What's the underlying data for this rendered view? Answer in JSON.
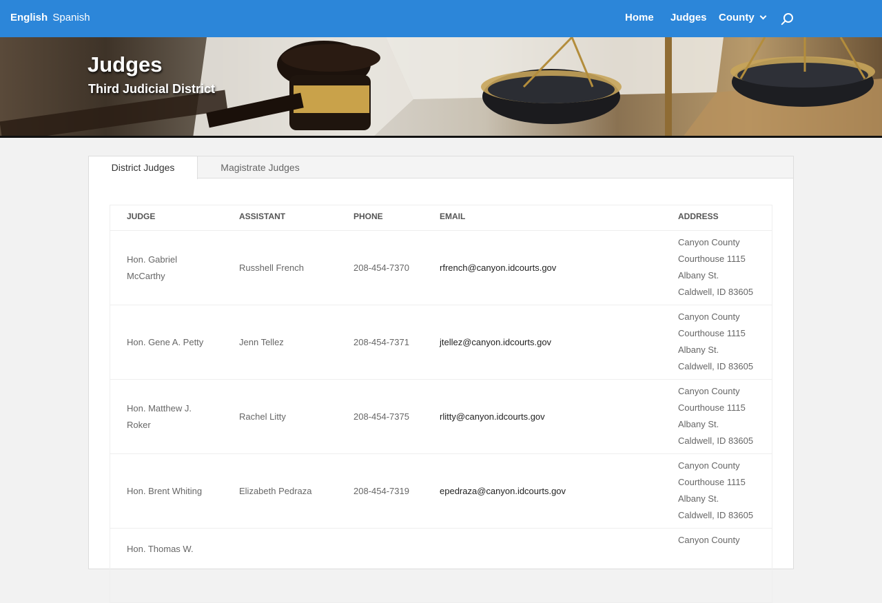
{
  "topbar": {
    "lang_english": "English",
    "lang_spanish": "Spanish",
    "nav": {
      "home": "Home",
      "judges": "Judges",
      "county": "County"
    }
  },
  "hero": {
    "title": "Judges",
    "subtitle": "Third Judicial District"
  },
  "tabs": [
    {
      "label": "District Judges",
      "active": true
    },
    {
      "label": "Magistrate Judges",
      "active": false
    }
  ],
  "table": {
    "headers": {
      "judge": "JUDGE",
      "assistant": "ASSISTANT",
      "phone": "PHONE",
      "email": "EMAIL",
      "address": "ADDRESS"
    },
    "rows": [
      {
        "judge_line1": "Hon. Gabriel",
        "judge_line2": "McCarthy",
        "assistant": "Russhell French",
        "phone": "208-454-7370",
        "email": "rfrench@canyon.idcourts.gov",
        "address": [
          "Canyon County",
          "Courthouse 1115",
          "Albany St.",
          "Caldwell, ID 83605"
        ]
      },
      {
        "judge_line1": "Hon. Gene A. Petty",
        "judge_line2": "",
        "assistant": "Jenn Tellez",
        "phone": "208-454-7371",
        "email": "jtellez@canyon.idcourts.gov",
        "address": [
          "Canyon County",
          "Courthouse 1115",
          "Albany St.",
          "Caldwell, ID 83605"
        ]
      },
      {
        "judge_line1": "Hon. Matthew J.",
        "judge_line2": "Roker",
        "assistant": "Rachel Litty",
        "phone": "208-454-7375",
        "email": "rlitty@canyon.idcourts.gov",
        "address": [
          "Canyon County",
          "Courthouse 1115",
          "Albany St.",
          "Caldwell, ID 83605"
        ]
      },
      {
        "judge_line1": "Hon. Brent Whiting",
        "judge_line2": "",
        "assistant": "Elizabeth Pedraza",
        "phone": "208-454-7319",
        "email": "epedraza@canyon.idcourts.gov",
        "address": [
          "Canyon County",
          "Courthouse 1115",
          "Albany St.",
          "Caldwell, ID 83605"
        ]
      },
      {
        "judge_line1": "Hon. Thomas W.",
        "judge_line2": "",
        "assistant": "",
        "phone": "",
        "email": "",
        "address": [
          "Canyon County",
          "",
          "",
          ""
        ]
      }
    ]
  }
}
